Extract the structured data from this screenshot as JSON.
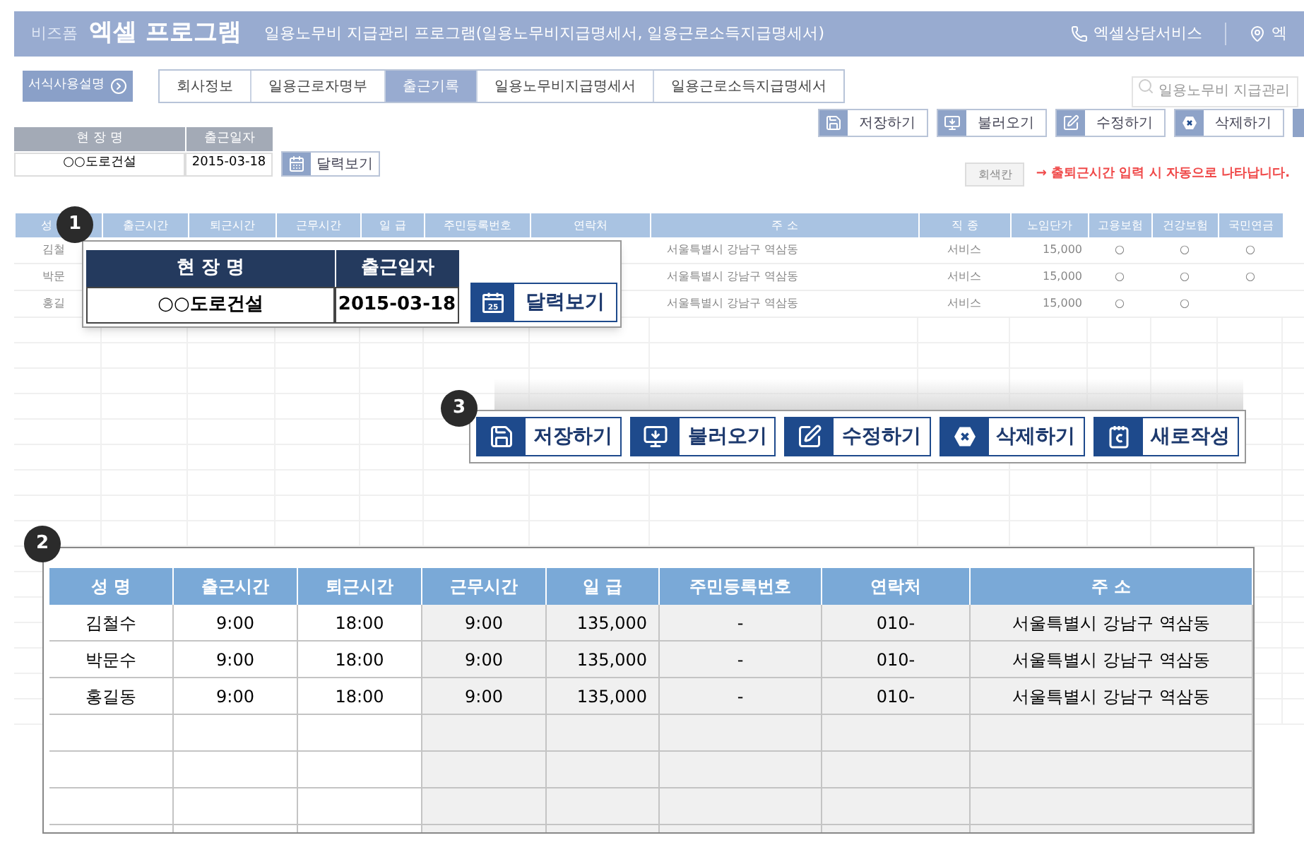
{
  "header": {
    "brand_small": "비즈폼",
    "brand": "엑셀 프로그램",
    "subtitle": "일용노무비 지급관리 프로그램(일용노무비지급명세서, 일용근로소득지급명세서)",
    "links": [
      {
        "kind": "phone",
        "label": "엑셀상담서비스"
      },
      {
        "kind": "pin",
        "label": "엑"
      }
    ]
  },
  "nav": {
    "guide_button": "서식사용설명",
    "tabs": [
      {
        "label": "회사정보",
        "selected": false
      },
      {
        "label": "일용근로자명부",
        "selected": false
      },
      {
        "label": "출근기록",
        "selected": true
      },
      {
        "label": "일용노무비지급명세서",
        "selected": false
      },
      {
        "label": "일용근로소득지급명세서",
        "selected": false
      }
    ],
    "search": {
      "placeholder": "일용노무비 지급관리"
    }
  },
  "site_form": {
    "columns": [
      "현 장 명",
      "출근일자"
    ],
    "values": [
      "○○도로건설",
      "2015-03-18"
    ],
    "calendar_button": "달력보기"
  },
  "toolbar": [
    {
      "kind": "save",
      "label": "저장하기"
    },
    {
      "kind": "load",
      "label": "불러오기"
    },
    {
      "kind": "edit",
      "label": "수정하기"
    },
    {
      "kind": "delete",
      "label": "삭제하기"
    }
  ],
  "legend": {
    "swatch": "회색칸",
    "note": "→ 출퇴근시간 입력 시 자동으로 나타납니다."
  },
  "grid": {
    "columns": [
      "성",
      "출근시간",
      "퇴근시간",
      "근무시간",
      "일 급",
      "주민등록번호",
      "연락처",
      "주 소",
      "직 종",
      "노임단가",
      "고용보험",
      "건강보험",
      "국민연금"
    ],
    "rows": [
      {
        "name": "김철",
        "address": "서울특별시 강남구 역삼동",
        "job": "서비스",
        "wage": "15,000",
        "insurance": [
          "○",
          "○",
          "○"
        ]
      },
      {
        "name": "박문",
        "address": "서울특별시 강남구 역삼동",
        "job": "서비스",
        "wage": "15,000",
        "insurance": [
          "○",
          "○",
          "○"
        ]
      },
      {
        "name": "홍길",
        "address": "서울특별시 강남구 역삼동",
        "job": "서비스",
        "wage": "15,000",
        "insurance": [
          "○",
          "○"
        ]
      }
    ]
  },
  "callout_1": {
    "number": "1",
    "columns": [
      "현 장 명",
      "출근일자"
    ],
    "values": [
      "○○도로건설",
      "2015-03-18"
    ],
    "calendar_button": "달력보기",
    "calendar_day": "25"
  },
  "callout_3": {
    "number": "3",
    "buttons": [
      {
        "kind": "save",
        "label": "저장하기"
      },
      {
        "kind": "load",
        "label": "불러오기"
      },
      {
        "kind": "edit",
        "label": "수정하기"
      },
      {
        "kind": "delete",
        "label": "삭제하기"
      },
      {
        "kind": "new",
        "label": "새로작성"
      }
    ]
  },
  "callout_2": {
    "number": "2",
    "columns": [
      "성 명",
      "출근시간",
      "퇴근시간",
      "근무시간",
      "일 급",
      "주민등록번호",
      "연락처",
      "주 소"
    ],
    "rows": [
      {
        "cells": [
          "김철수",
          "9:00",
          "18:00",
          "9:00",
          "135,000",
          "-",
          "010-",
          "서울특별시 강남구 역삼동"
        ]
      },
      {
        "cells": [
          "박문수",
          "9:00",
          "18:00",
          "9:00",
          "135,000",
          "-",
          "010-",
          "서울특별시 강남구 역삼동"
        ]
      },
      {
        "cells": [
          "홍길동",
          "9:00",
          "18:00",
          "9:00",
          "135,000",
          "-",
          "010-",
          "서울특별시 강남구 역삼동"
        ]
      }
    ]
  }
}
